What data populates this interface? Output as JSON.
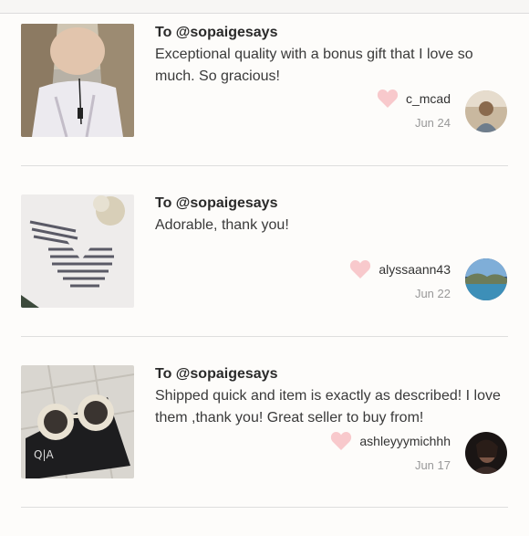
{
  "reviews": [
    {
      "to": "To @sopaigesays",
      "message": "Exceptional quality with a bonus gift that I love so much. So gracious!",
      "username": "c_mcad",
      "date": "Jun 24"
    },
    {
      "to": "To @sopaigesays",
      "message": "Adorable, thank you!",
      "username": "alyssaann43",
      "date": "Jun 22"
    },
    {
      "to": "To @sopaigesays",
      "message": "Shipped quick and item is exactly as described! I love them ,thank you! Great seller to buy from!",
      "username": "ashleyyymichhh",
      "date": "Jun 17"
    }
  ],
  "colors": {
    "heart": "#f8c9cc",
    "divider": "#dedede",
    "muted_text": "#999999"
  }
}
